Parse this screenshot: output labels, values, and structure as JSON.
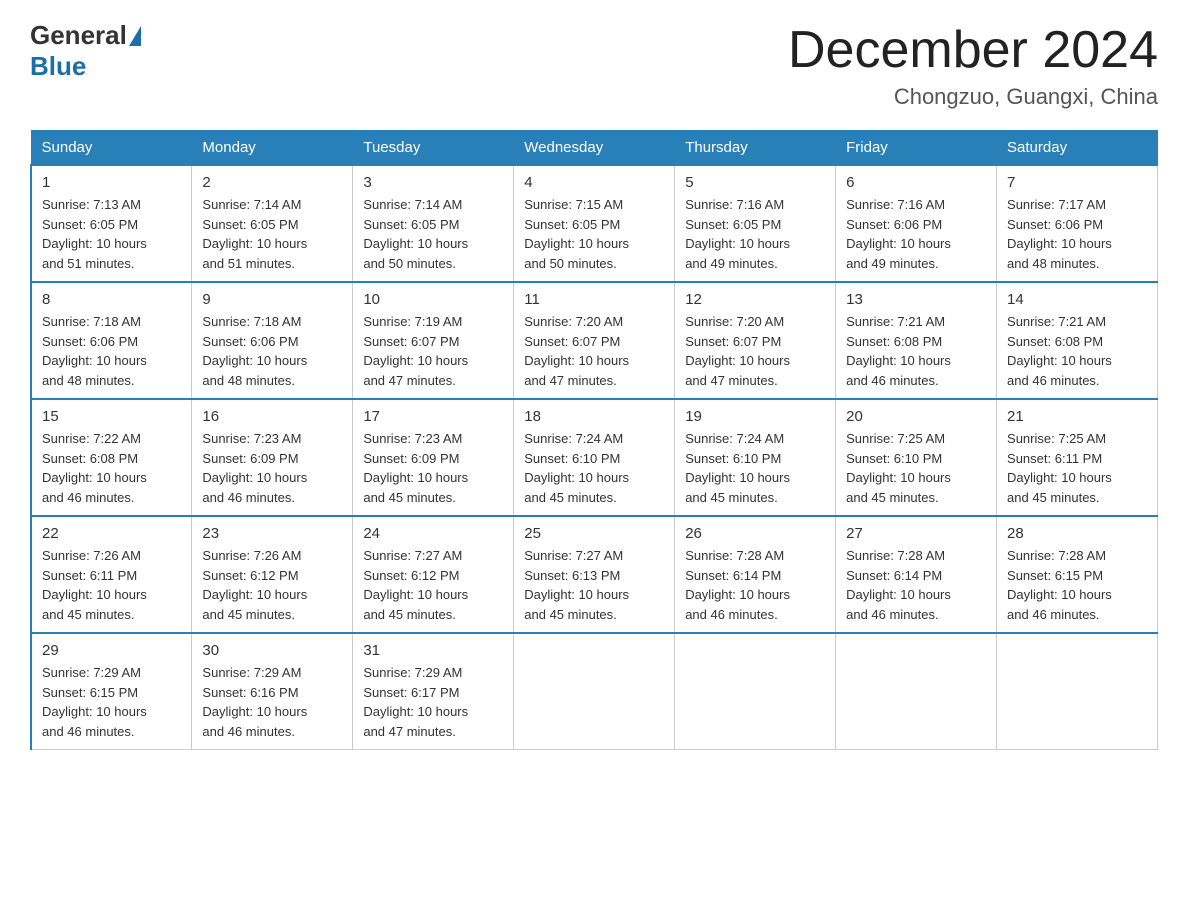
{
  "logo": {
    "general": "General",
    "blue": "Blue"
  },
  "title": "December 2024",
  "location": "Chongzuo, Guangxi, China",
  "days_of_week": [
    "Sunday",
    "Monday",
    "Tuesday",
    "Wednesday",
    "Thursday",
    "Friday",
    "Saturday"
  ],
  "weeks": [
    [
      {
        "day": "1",
        "sunrise": "7:13 AM",
        "sunset": "6:05 PM",
        "daylight": "10 hours and 51 minutes."
      },
      {
        "day": "2",
        "sunrise": "7:14 AM",
        "sunset": "6:05 PM",
        "daylight": "10 hours and 51 minutes."
      },
      {
        "day": "3",
        "sunrise": "7:14 AM",
        "sunset": "6:05 PM",
        "daylight": "10 hours and 50 minutes."
      },
      {
        "day": "4",
        "sunrise": "7:15 AM",
        "sunset": "6:05 PM",
        "daylight": "10 hours and 50 minutes."
      },
      {
        "day": "5",
        "sunrise": "7:16 AM",
        "sunset": "6:05 PM",
        "daylight": "10 hours and 49 minutes."
      },
      {
        "day": "6",
        "sunrise": "7:16 AM",
        "sunset": "6:06 PM",
        "daylight": "10 hours and 49 minutes."
      },
      {
        "day": "7",
        "sunrise": "7:17 AM",
        "sunset": "6:06 PM",
        "daylight": "10 hours and 48 minutes."
      }
    ],
    [
      {
        "day": "8",
        "sunrise": "7:18 AM",
        "sunset": "6:06 PM",
        "daylight": "10 hours and 48 minutes."
      },
      {
        "day": "9",
        "sunrise": "7:18 AM",
        "sunset": "6:06 PM",
        "daylight": "10 hours and 48 minutes."
      },
      {
        "day": "10",
        "sunrise": "7:19 AM",
        "sunset": "6:07 PM",
        "daylight": "10 hours and 47 minutes."
      },
      {
        "day": "11",
        "sunrise": "7:20 AM",
        "sunset": "6:07 PM",
        "daylight": "10 hours and 47 minutes."
      },
      {
        "day": "12",
        "sunrise": "7:20 AM",
        "sunset": "6:07 PM",
        "daylight": "10 hours and 47 minutes."
      },
      {
        "day": "13",
        "sunrise": "7:21 AM",
        "sunset": "6:08 PM",
        "daylight": "10 hours and 46 minutes."
      },
      {
        "day": "14",
        "sunrise": "7:21 AM",
        "sunset": "6:08 PM",
        "daylight": "10 hours and 46 minutes."
      }
    ],
    [
      {
        "day": "15",
        "sunrise": "7:22 AM",
        "sunset": "6:08 PM",
        "daylight": "10 hours and 46 minutes."
      },
      {
        "day": "16",
        "sunrise": "7:23 AM",
        "sunset": "6:09 PM",
        "daylight": "10 hours and 46 minutes."
      },
      {
        "day": "17",
        "sunrise": "7:23 AM",
        "sunset": "6:09 PM",
        "daylight": "10 hours and 45 minutes."
      },
      {
        "day": "18",
        "sunrise": "7:24 AM",
        "sunset": "6:10 PM",
        "daylight": "10 hours and 45 minutes."
      },
      {
        "day": "19",
        "sunrise": "7:24 AM",
        "sunset": "6:10 PM",
        "daylight": "10 hours and 45 minutes."
      },
      {
        "day": "20",
        "sunrise": "7:25 AM",
        "sunset": "6:10 PM",
        "daylight": "10 hours and 45 minutes."
      },
      {
        "day": "21",
        "sunrise": "7:25 AM",
        "sunset": "6:11 PM",
        "daylight": "10 hours and 45 minutes."
      }
    ],
    [
      {
        "day": "22",
        "sunrise": "7:26 AM",
        "sunset": "6:11 PM",
        "daylight": "10 hours and 45 minutes."
      },
      {
        "day": "23",
        "sunrise": "7:26 AM",
        "sunset": "6:12 PM",
        "daylight": "10 hours and 45 minutes."
      },
      {
        "day": "24",
        "sunrise": "7:27 AM",
        "sunset": "6:12 PM",
        "daylight": "10 hours and 45 minutes."
      },
      {
        "day": "25",
        "sunrise": "7:27 AM",
        "sunset": "6:13 PM",
        "daylight": "10 hours and 45 minutes."
      },
      {
        "day": "26",
        "sunrise": "7:28 AM",
        "sunset": "6:14 PM",
        "daylight": "10 hours and 46 minutes."
      },
      {
        "day": "27",
        "sunrise": "7:28 AM",
        "sunset": "6:14 PM",
        "daylight": "10 hours and 46 minutes."
      },
      {
        "day": "28",
        "sunrise": "7:28 AM",
        "sunset": "6:15 PM",
        "daylight": "10 hours and 46 minutes."
      }
    ],
    [
      {
        "day": "29",
        "sunrise": "7:29 AM",
        "sunset": "6:15 PM",
        "daylight": "10 hours and 46 minutes."
      },
      {
        "day": "30",
        "sunrise": "7:29 AM",
        "sunset": "6:16 PM",
        "daylight": "10 hours and 46 minutes."
      },
      {
        "day": "31",
        "sunrise": "7:29 AM",
        "sunset": "6:17 PM",
        "daylight": "10 hours and 47 minutes."
      },
      null,
      null,
      null,
      null
    ]
  ],
  "labels": {
    "sunrise": "Sunrise:",
    "sunset": "Sunset:",
    "daylight": "Daylight:"
  }
}
